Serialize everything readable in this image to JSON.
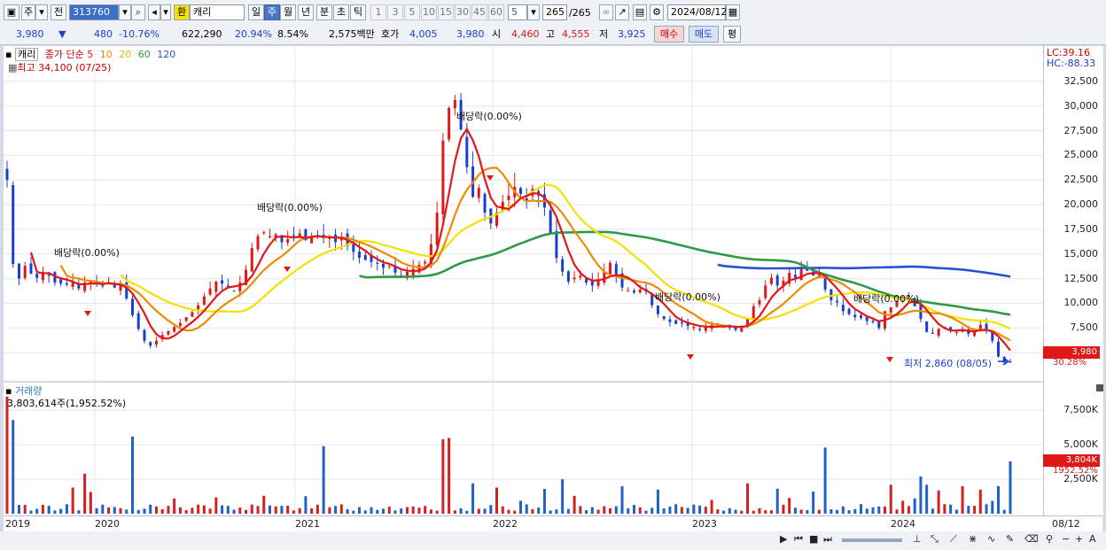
{
  "toolbar": {
    "period_label": "주",
    "prev_label": "전",
    "code": "313760",
    "fx_label": "환",
    "name": "캐리",
    "tabs": [
      "일",
      "주",
      "월",
      "년",
      "분",
      "초",
      "틱"
    ],
    "intervals": [
      "1",
      "3",
      "5",
      "10",
      "15",
      "30",
      "45",
      "60"
    ],
    "interval_value": "5",
    "count": "265",
    "total": "/265",
    "date": "2024/08/12"
  },
  "info": {
    "price": "3,980",
    "change_arrow": "▼",
    "change": "480",
    "change_pct": "-10.76%",
    "volume": "622,290",
    "volume_pct": "20.94%",
    "turnover": "8.54%",
    "amount": "2,575백만",
    "hoga_label": "호가",
    "hoga1": "4,005",
    "hoga2": "3,980",
    "open_label": "시",
    "open": "4,460",
    "high_label": "고",
    "high": "4,555",
    "low_label": "저",
    "low": "3,925",
    "buy_label": "매수",
    "sell_label": "매도",
    "eval_label": "평"
  },
  "price_panel": {
    "title": "캐리",
    "legend_main": "종가 단순",
    "ma": [
      "5",
      "10",
      "20",
      "60",
      "120"
    ],
    "ma_colors": [
      "#e01818",
      "#f08a00",
      "#f5e000",
      "#2e9a46",
      "#2850d0"
    ],
    "high_note": "최고 34,100 (07/25)",
    "low_note": "최저 2,860 (08/05)",
    "lc": "LC:39.16",
    "hc": "HC:-88.33",
    "current_tag": "3,980",
    "current_pct": "30.28%",
    "dividend_label": "배당락(0.00%)"
  },
  "volume_panel": {
    "title": "거래량",
    "note": "3,803,614주(1,952.52%)",
    "current_tag": "3,804K",
    "current_pct": "1952.52%"
  },
  "x_axis": [
    "2019",
    "2020",
    "2021",
    "2022",
    "2023",
    "2024",
    "08/12"
  ],
  "chart_data": {
    "type": "candlestick",
    "y_ticks": [
      "32,500",
      "30,000",
      "27,500",
      "25,000",
      "22,500",
      "20,000",
      "17,500",
      "15,000",
      "12,500",
      "10,000",
      "7,500",
      "5,000"
    ],
    "volume_ticks": [
      "7,500K",
      "5,000K",
      "2,500K"
    ],
    "price_ylim": [
      2500,
      35000
    ],
    "volume_ylim": [
      0,
      9000000
    ],
    "weekly_close_approx": [
      22500,
      14000,
      12500,
      13800,
      13000,
      12600,
      13200,
      12800,
      12100,
      12000,
      11900,
      12200,
      11500,
      12100,
      12300,
      12000,
      11800,
      12100,
      11600,
      12000,
      10500,
      8800,
      7400,
      6200,
      5700,
      6200,
      6800,
      7200,
      7600,
      8000,
      8600,
      9100,
      9800,
      10700,
      11500,
      12200,
      12000,
      11600,
      11200,
      12100,
      13400,
      15600,
      16800,
      17200,
      16800,
      17000,
      16200,
      16500,
      16900,
      17100,
      16400,
      16800,
      16900,
      16600,
      16800,
      16200,
      16700,
      15800,
      15200,
      14600,
      14400,
      14200,
      14000,
      13600,
      13800,
      13100,
      12800,
      13200,
      13500,
      13900,
      14200,
      16000,
      19200,
      26500,
      29800,
      30600,
      27600,
      23800,
      20800,
      21700,
      19200,
      18100,
      19200,
      20300,
      20900,
      21800,
      21100,
      20300,
      21600,
      20900,
      19700,
      17100,
      14600,
      13200,
      12200,
      12600,
      12800,
      12100,
      11800,
      12400,
      13200,
      14100,
      12800,
      11600,
      11300,
      11100,
      11400,
      11200,
      9800,
      8900,
      8400,
      8100,
      7900,
      8000,
      7700,
      7600,
      7300,
      7600,
      7800,
      7900,
      7600,
      7500,
      7300,
      7700,
      8500,
      9700,
      10300,
      11800,
      12600,
      11800,
      12300,
      13100,
      12600,
      13600,
      13300,
      12800,
      12900,
      11400,
      10300,
      10100,
      9200,
      8900,
      8600,
      8500,
      8200,
      8100,
      7500,
      9200,
      9600,
      10200,
      10600,
      10800,
      9700,
      8400,
      7100,
      6900,
      7400,
      7600,
      7200,
      7100,
      7200,
      6900,
      7400,
      7800,
      7300,
      6200,
      4600,
      4000,
      3980
    ]
  }
}
